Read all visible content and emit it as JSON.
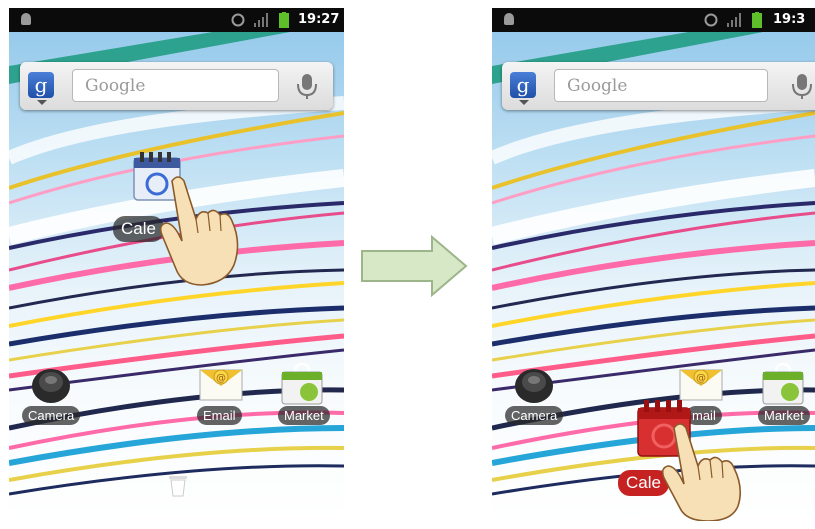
{
  "before": {
    "status_time": "19:27",
    "search": {
      "logo": "g",
      "placeholder": "Google"
    },
    "dragged_app": {
      "icon": "calendar-icon",
      "label": "Cale"
    },
    "dock_apps": [
      {
        "icon": "camera-icon",
        "label": "Camera"
      },
      {
        "icon": "email-icon",
        "label": "Email"
      },
      {
        "icon": "market-icon",
        "label": "Market"
      }
    ],
    "dock_icon": "trash-icon"
  },
  "after": {
    "status_time": "19:3",
    "search": {
      "logo": "g",
      "placeholder": "Google"
    },
    "dragged_app": {
      "icon": "calendar-icon",
      "label": "Cale",
      "state_color": "#c62222"
    },
    "dock_apps": [
      {
        "icon": "camera-icon",
        "label": "Camera"
      },
      {
        "icon": "email-icon",
        "label": "mail"
      },
      {
        "icon": "market-icon",
        "label": "Market"
      }
    ]
  },
  "transition_icon": "arrow-right-icon",
  "colors": {
    "statusbar": "#0b0b0b",
    "battery": "#5fbf2a",
    "delete_red": "#c62222",
    "arrow_fill": "#d7e8c6"
  }
}
